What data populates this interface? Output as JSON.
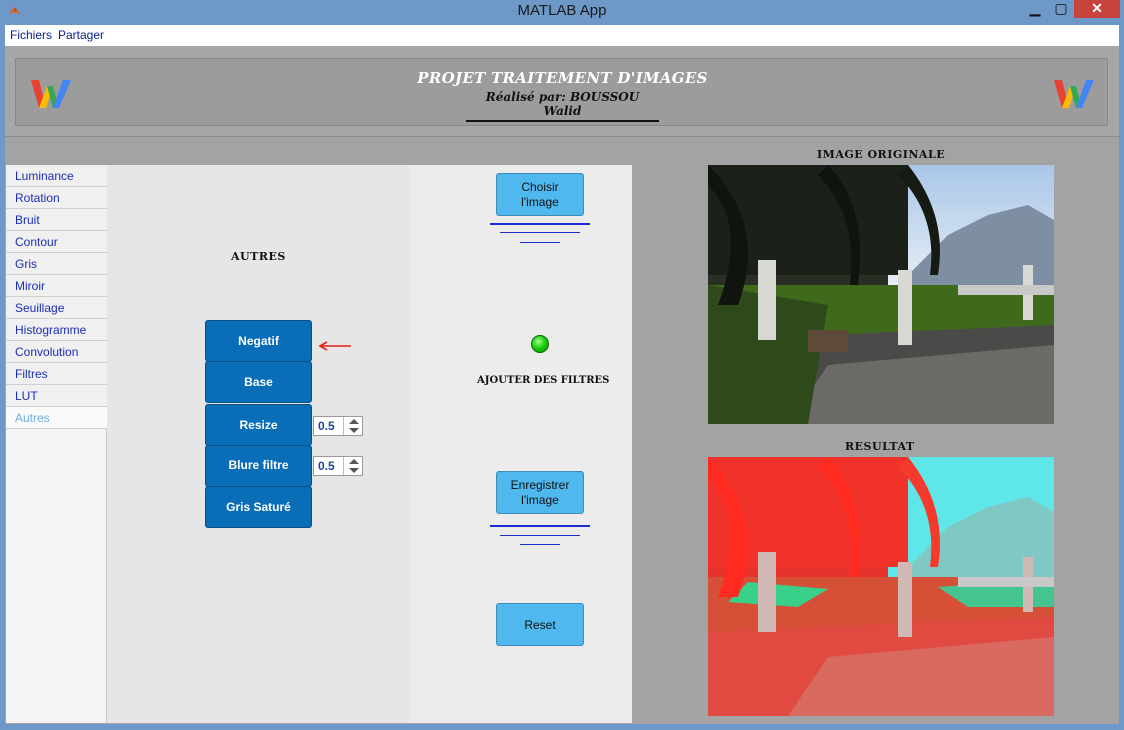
{
  "window": {
    "title": "MATLAB App",
    "minimize": "▁",
    "maximize": "▢",
    "close": "✕"
  },
  "menu": {
    "items": [
      "Fichiers",
      "Partager"
    ]
  },
  "header": {
    "title": "PROJET TRAITEMENT D'IMAGES",
    "subtitle": "Réalisé par: BOUSSOU Walid"
  },
  "tabs": {
    "items": [
      "Luminance",
      "Rotation",
      "Bruit",
      "Contour",
      "Gris",
      "Miroir",
      "Seuillage",
      "Histogramme",
      "Convolution",
      "Filtres",
      "LUT",
      "Autres"
    ],
    "active": "Autres"
  },
  "panel": {
    "section_label": "AUTRES",
    "buttons": [
      "Negatif",
      "Base",
      "Resize",
      "Blure filtre",
      "Gris Saturé"
    ],
    "resize_value": "0.5",
    "blur_value": "0.5",
    "choose_label_line1": "Choisir",
    "choose_label_line2": "l'image",
    "add_filters_label": "AJOUTER DES FILTRES",
    "save_label_line1": "Enregistrer",
    "save_label_line2": "l'image",
    "reset_label": "Reset"
  },
  "images": {
    "original_title": "IMAGE ORIGINALE",
    "result_title": "RESULTAT"
  },
  "colors": {
    "accent_dark": "#0a6db8",
    "accent_light": "#4fb8ee",
    "status_led": "#1ed010",
    "arrow": "#e0201a"
  }
}
